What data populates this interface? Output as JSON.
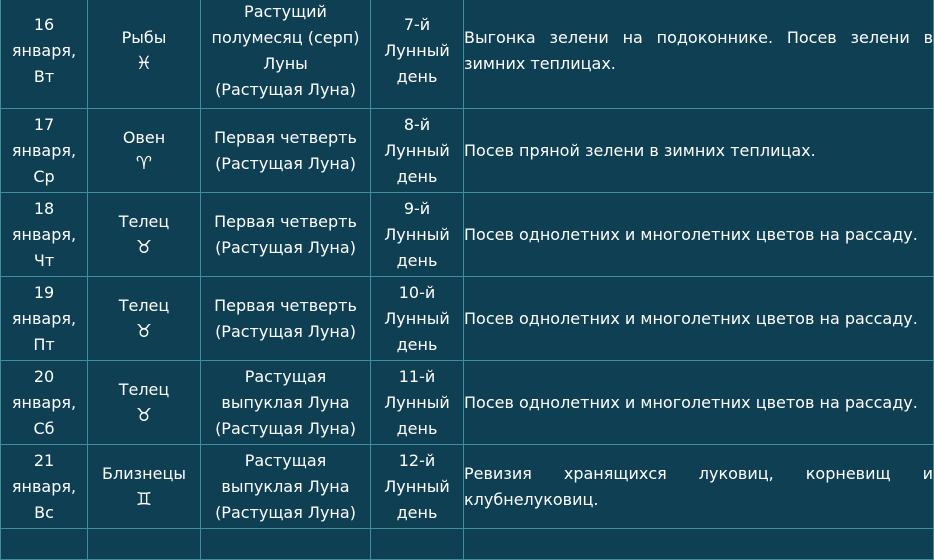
{
  "rows": [
    {
      "date": [
        "16",
        "января,",
        "Вт"
      ],
      "sign": "Рыбы",
      "sign_symbol": "♓︎",
      "sign_icon": "pisces-icon",
      "phase": [
        "Растущий",
        "полумесяц (серп)",
        "Луны",
        "(Растущая Луна)"
      ],
      "lunar_day": [
        "7-й",
        "Лунный",
        "день"
      ],
      "work": "Выгонка зелени на подоконнике. Посев зелени в зимних теплицах."
    },
    {
      "date": [
        "17",
        "января,",
        "Ср"
      ],
      "sign": "Овен",
      "sign_symbol": "♈︎",
      "sign_icon": "aries-icon",
      "phase": [
        "Первая четверть",
        "(Растущая Луна)"
      ],
      "lunar_day": [
        "8-й",
        "Лунный",
        "день"
      ],
      "work": "Посев пряной зелени в зимних теплицах."
    },
    {
      "date": [
        "18",
        "января,",
        "Чт"
      ],
      "sign": "Телец",
      "sign_symbol": "♉︎",
      "sign_icon": "taurus-icon",
      "phase": [
        "Первая четверть",
        "(Растущая Луна)"
      ],
      "lunar_day": [
        "9-й",
        "Лунный",
        "день"
      ],
      "work": "Посев однолетних и многолетних цветов на рассаду."
    },
    {
      "date": [
        "19",
        "января,",
        "Пт"
      ],
      "sign": "Телец",
      "sign_symbol": "♉︎",
      "sign_icon": "taurus-icon",
      "phase": [
        "Первая четверть",
        "(Растущая Луна)"
      ],
      "lunar_day": [
        "10-й",
        "Лунный",
        "день"
      ],
      "work": "Посев однолетних и многолетних цветов на рассаду."
    },
    {
      "date": [
        "20",
        "января,",
        "Сб"
      ],
      "sign": "Телец",
      "sign_symbol": "♉︎",
      "sign_icon": "taurus-icon",
      "phase": [
        "Растущая",
        "выпуклая Луна",
        "(Растущая Луна)"
      ],
      "lunar_day": [
        "11-й",
        "Лунный",
        "день"
      ],
      "work": "Посев однолетних и многолетних цветов на рассаду."
    },
    {
      "date": [
        "21",
        "января,",
        "Вс"
      ],
      "sign": "Близнецы",
      "sign_symbol": "♊︎",
      "sign_icon": "gemini-icon",
      "phase": [
        "Растущая",
        "выпуклая Луна",
        "(Растущая Луна)"
      ],
      "lunar_day": [
        "12-й",
        "Лунный",
        "день"
      ],
      "work": "Ревизия хранящихся луковиц, корневищ и клубнелуковиц."
    }
  ]
}
